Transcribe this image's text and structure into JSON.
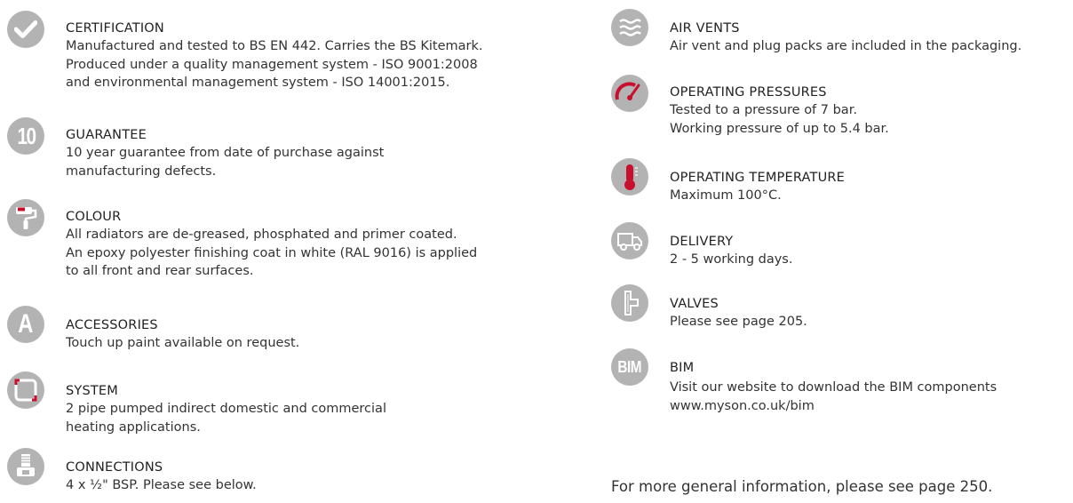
{
  "left": [
    {
      "icon": "checkmark-icon",
      "title": "CERTIFICATION",
      "lines": [
        "Manufactured and tested to BS EN 442. Carries the BS Kitemark.",
        "Produced under a quality management system - ISO 9001:2008",
        "and environmental management system - ISO 14001:2015."
      ]
    },
    {
      "icon": "number-10-icon",
      "icon_text": "10",
      "title": "GUARANTEE",
      "lines": [
        "10 year guarantee from date of purchase against",
        "manufacturing defects."
      ]
    },
    {
      "icon": "paint-roller-icon",
      "title": "COLOUR",
      "lines": [
        "All radiators are de-greased, phosphated and primer coated.",
        "An epoxy polyester finishing coat in white (RAL 9016) is applied",
        "to all front and rear surfaces."
      ]
    },
    {
      "icon": "letter-a-icon",
      "icon_text": "A",
      "title": "ACCESSORIES",
      "lines": [
        "Touch up paint available on request."
      ]
    },
    {
      "icon": "system-circuit-icon",
      "title": "SYSTEM",
      "lines": [
        "2 pipe pumped indirect domestic and commercial",
        "heating applications."
      ]
    },
    {
      "icon": "connection-fitting-icon",
      "title": "CONNECTIONS",
      "lines": [
        "4 x ½\" BSP. Please see below."
      ]
    }
  ],
  "right": [
    {
      "icon": "air-waves-icon",
      "title": "AIR VENTS",
      "lines": [
        "Air vent and plug packs are included in the packaging."
      ]
    },
    {
      "icon": "pressure-gauge-icon",
      "title": "OPERATING PRESSURES",
      "lines": [
        "Tested to a pressure of 7 bar.",
        "Working pressure of up to 5.4 bar."
      ]
    },
    {
      "icon": "thermometer-icon",
      "title": "OPERATING TEMPERATURE",
      "lines": [
        "Maximum 100°C."
      ]
    },
    {
      "icon": "delivery-truck-icon",
      "title": "DELIVERY",
      "lines": [
        "2 - 5 working days."
      ]
    },
    {
      "icon": "valve-icon",
      "title": "VALVES",
      "lines": [
        "Please see page 205."
      ]
    },
    {
      "icon": "bim-icon",
      "icon_text": "BIM",
      "title": "BIM",
      "lines": [
        "",
        "Visit our website to download the BIM components",
        "www.myson.co.uk/bim"
      ]
    }
  ],
  "footer": "For more general information, please see page 250.",
  "colors": {
    "icon_grey": "#b3b3b3",
    "accent_red": "#c8102e",
    "text": "#333333"
  }
}
